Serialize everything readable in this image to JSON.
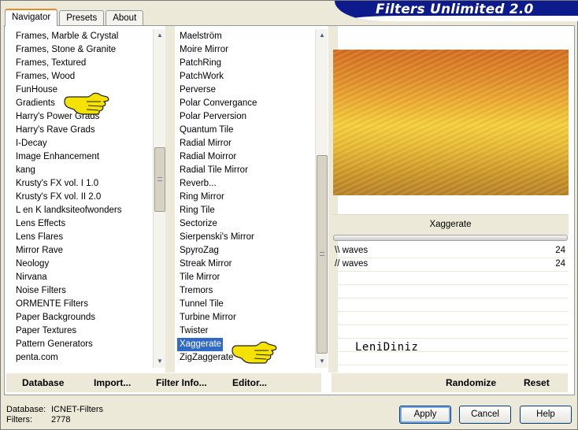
{
  "banner": {
    "title": "Filters Unlimited 2.0"
  },
  "tabs": [
    {
      "label": "Navigator",
      "active": true
    },
    {
      "label": "Presets",
      "active": false
    },
    {
      "label": "About",
      "active": false
    }
  ],
  "categories": [
    "Frames, Marble & Crystal",
    "Frames, Stone & Granite",
    "Frames, Textured",
    "Frames, Wood",
    "FunHouse",
    "Gradients",
    "Harry's Power Grads",
    "Harry's Rave Grads",
    "I-Decay",
    "Image Enhancement",
    "kang",
    "Krusty's FX vol. I 1.0",
    "Krusty's FX vol. II 2.0",
    "L en K landksiteofwonders",
    "Lens Effects",
    "Lens Flares",
    "Mirror Rave",
    "Neology",
    "Nirvana",
    "Noise Filters",
    "ORMENTE Filters",
    "Paper Backgrounds",
    "Paper Textures",
    "Pattern Generators",
    "penta.com"
  ],
  "filters": [
    "Maelström",
    "Moire Mirror",
    "PatchRing",
    "PatchWork",
    "Perverse",
    "Polar Convergance",
    "Polar Perversion",
    "Quantum Tile",
    "Radial Mirror",
    "Radial Moirror",
    "Radial Tile Mirror",
    "Reverb...",
    "Ring Mirror",
    "Ring Tile",
    "Sectorize",
    "Sierpenski's Mirror",
    "SpyroZag",
    "Streak Mirror",
    "Tile Mirror",
    "Tremors",
    "Tunnel Tile",
    "Turbine Mirror",
    "Twister",
    "Xaggerate",
    "ZigZaggerate"
  ],
  "selected_filter_index": 23,
  "scrollbars": {
    "up_icon": "triangle-up-icon",
    "down_icon": "triangle-down-icon"
  },
  "preview": {
    "filter_name": "Xaggerate"
  },
  "params": [
    {
      "name": "\\\\ waves",
      "value": "24"
    },
    {
      "name": "// waves",
      "value": "24"
    }
  ],
  "signature": "LeniDiniz",
  "links": {
    "database": "Database",
    "import": "Import...",
    "filter_info": "Filter Info...",
    "editor": "Editor...",
    "randomize": "Randomize",
    "reset": "Reset"
  },
  "status": {
    "database_label": "Database:",
    "database_value": "ICNET-Filters",
    "filters_label": "Filters:",
    "filters_value": "2778"
  },
  "buttons": {
    "apply": "Apply",
    "cancel": "Cancel",
    "help": "Help"
  },
  "colors": {
    "accent": "#0c1a8c",
    "selection": "#316ac5"
  }
}
